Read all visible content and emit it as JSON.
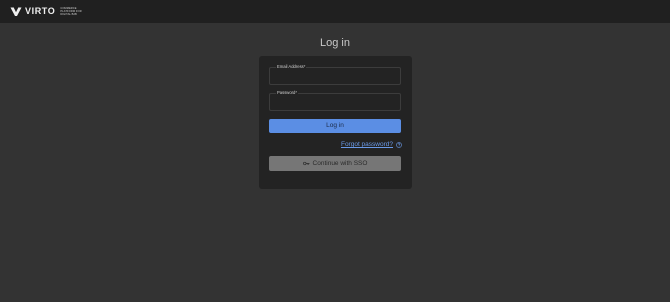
{
  "header": {
    "logo_text": "VIRTO",
    "logo_tagline": [
      "COMMERCE",
      "PLATFORM FOR",
      "DIGITAL B2B"
    ]
  },
  "page_title": "Log in",
  "form": {
    "email": {
      "label": "Email Address*",
      "value": "",
      "placeholder": ""
    },
    "password": {
      "label": "Password*",
      "value": "",
      "placeholder": ""
    },
    "login_button": "Log in",
    "forgot_password": "Forgot password?",
    "sso_button": "Continue with SSO"
  },
  "colors": {
    "page_bg": "#333333",
    "topbar_bg": "#202020",
    "card_bg": "#232323",
    "primary": "#5b8ee4",
    "link": "#6a9ae8",
    "sso_bg": "#767676"
  },
  "icons": {
    "logo": "virto-logo-icon",
    "help": "help-circle-icon",
    "sso": "key-icon"
  }
}
